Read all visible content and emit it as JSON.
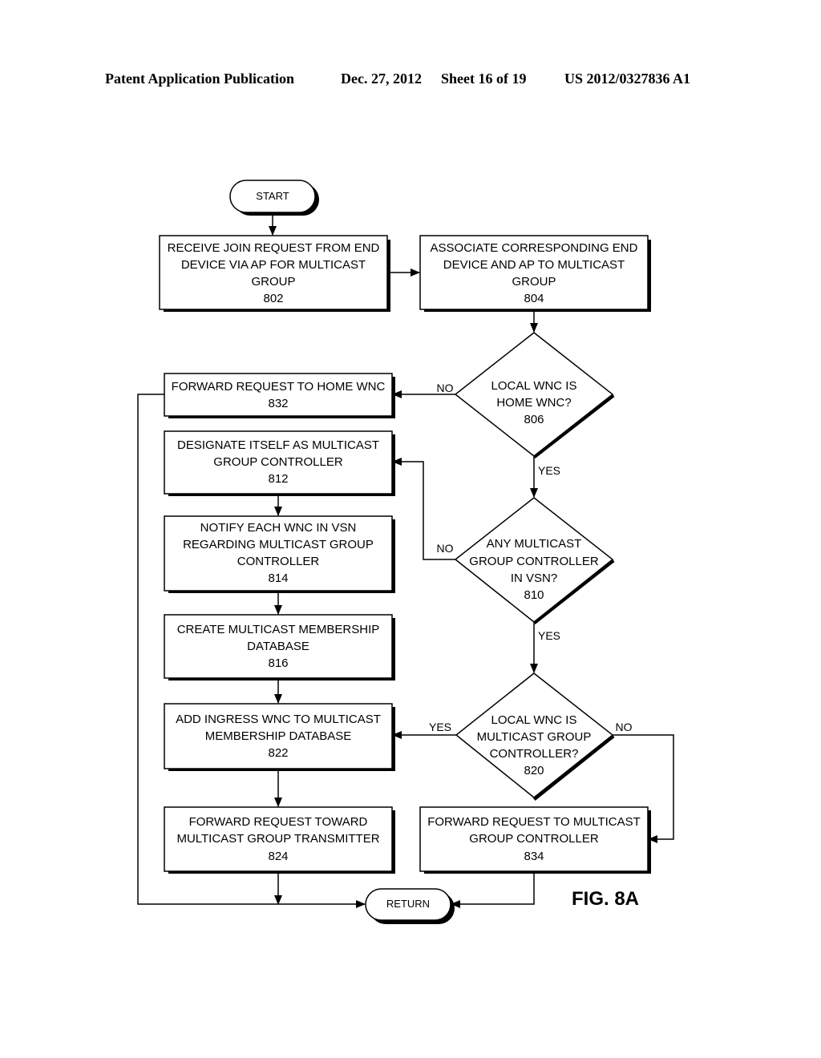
{
  "header": {
    "publication": "Patent Application Publication",
    "date": "Dec. 27, 2012",
    "sheet": "Sheet 16 of 19",
    "number": "US 2012/0327836 A1"
  },
  "figure_label": "FIG. 8A",
  "terminals": {
    "start": "START",
    "return": "RETURN"
  },
  "boxes": {
    "b802": {
      "lines": [
        "RECEIVE JOIN REQUEST FROM END",
        "DEVICE VIA AP FOR MULTICAST",
        "GROUP"
      ],
      "ref": "802"
    },
    "b804": {
      "lines": [
        "ASSOCIATE CORRESPONDING END",
        "DEVICE AND AP TO MULTICAST",
        "GROUP"
      ],
      "ref": "804"
    },
    "b832": {
      "lines": [
        "FORWARD REQUEST TO HOME WNC"
      ],
      "ref": "832"
    },
    "b812": {
      "lines": [
        "DESIGNATE ITSELF AS MULTICAST",
        "GROUP CONTROLLER"
      ],
      "ref": "812"
    },
    "b814": {
      "lines": [
        "NOTIFY EACH WNC IN VSN",
        "REGARDING MULTICAST GROUP",
        "CONTROLLER"
      ],
      "ref": "814"
    },
    "b816": {
      "lines": [
        "CREATE MULTICAST MEMBERSHIP",
        "DATABASE"
      ],
      "ref": "816"
    },
    "b822": {
      "lines": [
        "ADD INGRESS WNC TO MULTICAST",
        "MEMBERSHIP DATABASE"
      ],
      "ref": "822"
    },
    "b824": {
      "lines": [
        "FORWARD REQUEST TOWARD",
        "MULTICAST GROUP TRANSMITTER"
      ],
      "ref": "824"
    },
    "b834": {
      "lines": [
        "FORWARD REQUEST TO MULTICAST",
        "GROUP CONTROLLER"
      ],
      "ref": "834"
    }
  },
  "decisions": {
    "d806": {
      "lines": [
        "LOCAL WNC IS",
        "HOME WNC?"
      ],
      "ref": "806"
    },
    "d810": {
      "lines": [
        "ANY MULTICAST",
        "GROUP CONTROLLER",
        "IN VSN?"
      ],
      "ref": "810"
    },
    "d820": {
      "lines": [
        "LOCAL WNC IS",
        "MULTICAST GROUP",
        "CONTROLLER?"
      ],
      "ref": "820"
    }
  },
  "edge_labels": {
    "d806_no": "NO",
    "d806_yes": "YES",
    "d810_no": "NO",
    "d810_yes": "YES",
    "d820_yes": "YES",
    "d820_no": "NO"
  }
}
